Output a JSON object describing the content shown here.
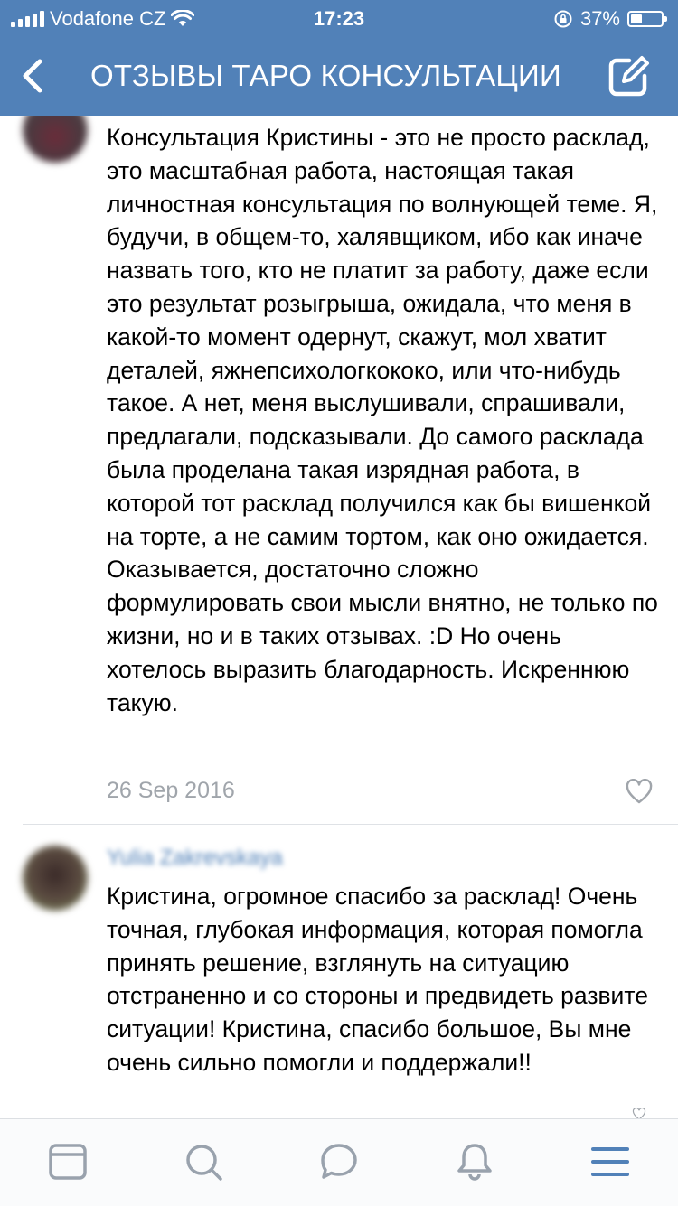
{
  "status_bar": {
    "carrier": "Vodafone CZ",
    "time": "17:23",
    "battery": "37%",
    "battery_level": 0.37
  },
  "header": {
    "title": "ОТЗЫВЫ ТАРО КОНСУЛЬТАЦИИ",
    "back_icon": "chevron-left-icon",
    "edit_icon": "compose-icon"
  },
  "comments": [
    {
      "text": "Консультация Кристины - это не просто расклад, это масштабная работа, настоящая такая личностная консультация по волнующей теме. Я, будучи, в общем-то, халявщиком, ибо как иначе назвать того, кто не платит за работу, даже если это результат розыгрыша, ожидала, что меня в какой-то момент одернут, скажут, мол хватит деталей, яжнепсихологкококо, или что-нибудь такое. А нет, меня выслушивали, спрашивали, предлагали, подсказывали. До самого расклада была проделана такая изрядная работа, в которой тот расклад получился как бы вишенкой на торте, а не самим тортом, как оно ожидается. Оказывается, достаточно сложно формулировать свои мысли внятно, не только по жизни, но и в таких отзывах. :D Но очень хотелось выразить благодарность. Искреннюю такую.",
      "date": "26 Sep 2016"
    },
    {
      "author": "Yulia Zakrevskaya",
      "text": "Кристина, огромное спасибо за расклад! Очень точная, глубокая информация, которая помогла принять решение, взглянуть на ситуацию отстраненно и со стороны и предвидеть развите ситуации! Кристина, спасибо большое, Вы мне очень сильно помогли и поддержали!!"
    }
  ],
  "tabbar": {
    "icons": [
      "feed-icon",
      "search-icon",
      "messages-icon",
      "notifications-icon",
      "menu-icon"
    ]
  },
  "colors": {
    "header_bg": "#5181b8",
    "date_text": "#a0a5ab",
    "accent": "#5181b8"
  }
}
